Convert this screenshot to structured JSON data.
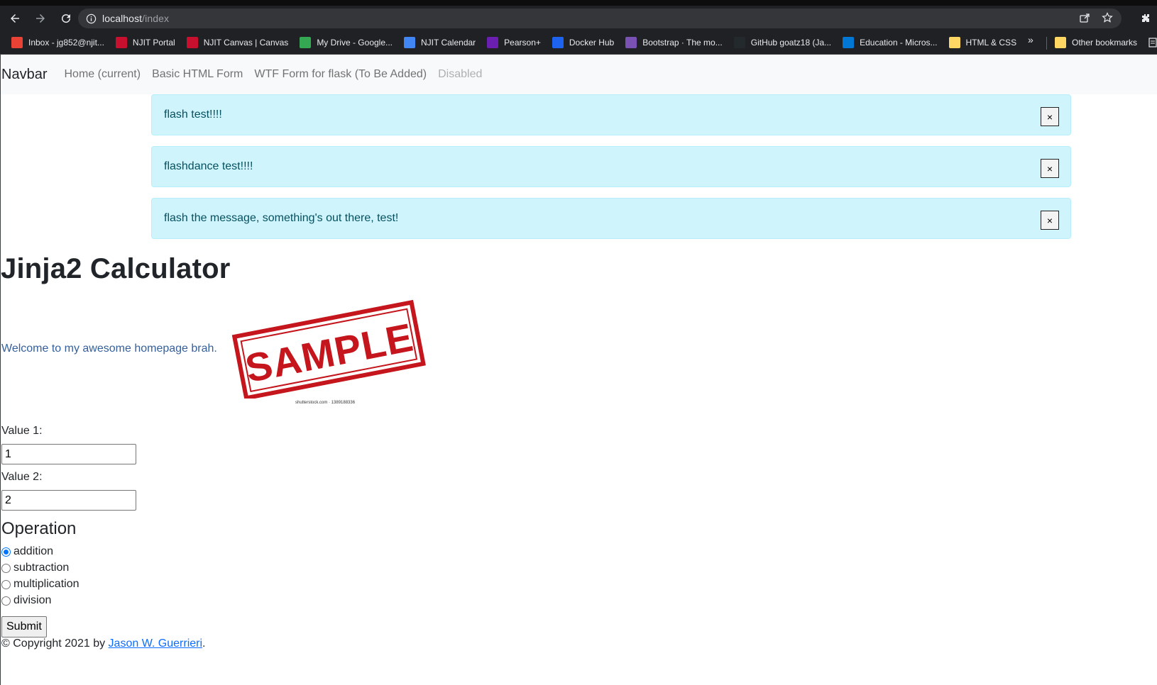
{
  "browser": {
    "url_host": "localhost",
    "url_path": "/index",
    "bookmarks": [
      {
        "label": "Inbox - jg852@njit...",
        "icon": "gmail-icon",
        "color": "#ea4335"
      },
      {
        "label": "NJIT Portal",
        "icon": "njit-icon",
        "color": "#c8102e"
      },
      {
        "label": "NJIT Canvas | Canvas",
        "icon": "njit-icon",
        "color": "#c8102e"
      },
      {
        "label": "My Drive - Google...",
        "icon": "google-drive-icon",
        "color": "#34a853"
      },
      {
        "label": "NJIT Calendar",
        "icon": "calendar-icon",
        "color": "#4285f4"
      },
      {
        "label": "Pearson+",
        "icon": "pearson-icon",
        "color": "#6b1fb1"
      },
      {
        "label": "Docker Hub",
        "icon": "docker-icon",
        "color": "#1d63ed"
      },
      {
        "label": "Bootstrap · The mo...",
        "icon": "bootstrap-icon",
        "color": "#7952b3"
      },
      {
        "label": "GitHub goatz18 (Ja...",
        "icon": "github-icon",
        "color": "#24292e"
      },
      {
        "label": "Education - Micros...",
        "icon": "azure-icon",
        "color": "#0078d4"
      },
      {
        "label": "HTML & CSS",
        "icon": "folder-icon",
        "color": "#fdd663"
      }
    ],
    "more_bookmarks": "»",
    "other_bookmarks": "Other bookmarks"
  },
  "navbar": {
    "brand": "Navbar",
    "links": [
      "Home (current)",
      "Basic HTML Form",
      "WTF Form for flask (To Be Added)"
    ],
    "disabled_link": "Disabled"
  },
  "alerts": [
    {
      "message": "flash test!!!!",
      "close": "×"
    },
    {
      "message": "flashdance test!!!!",
      "close": "×"
    },
    {
      "message": "flash the message, something's out there, test!",
      "close": "×"
    }
  ],
  "main": {
    "title": "Jinja2 Calculator",
    "welcome": "Welcome to my awesome homepage brah.",
    "stamp_text": "SAMPLE",
    "stamp_credit": "shutterstock.com · 1389188336"
  },
  "form": {
    "value1_label": "Value 1:",
    "value1": "1",
    "value2_label": "Value 2:",
    "value2": "2",
    "operation_heading": "Operation",
    "operations": [
      "addition",
      "subtraction",
      "multiplication",
      "division"
    ],
    "selected_operation": "addition",
    "submit_label": "Submit"
  },
  "footer": {
    "prefix": "© Copyright 2021 by ",
    "author": "Jason W. Guerrieri",
    "suffix": "."
  },
  "colors": {
    "alert_bg": "#cff4fc",
    "alert_text": "#055160",
    "welcome_text": "#35609b",
    "link": "#0d6efd",
    "stamp_red": "#c4161c"
  }
}
